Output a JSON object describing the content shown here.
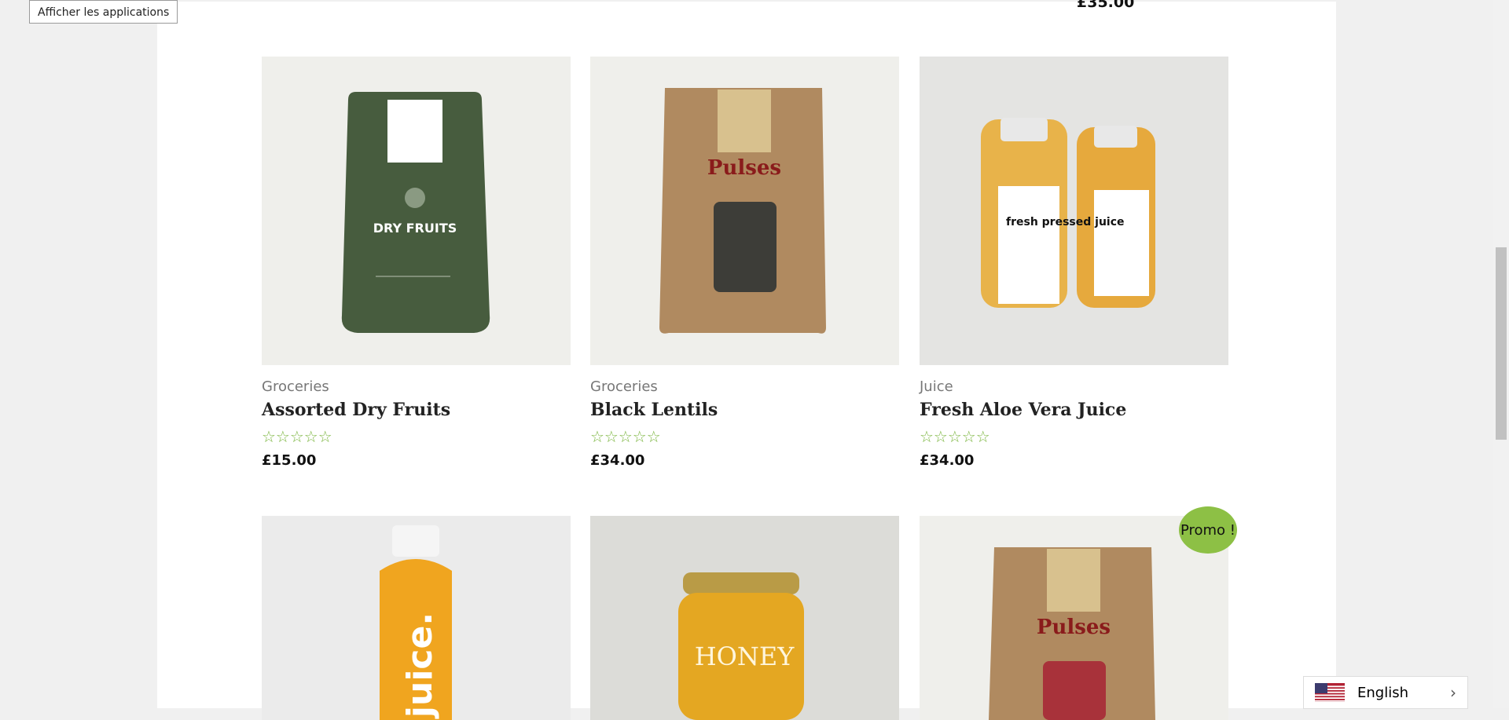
{
  "tooltip": "Afficher les applications",
  "top_price": "£35.00",
  "products": [
    {
      "category": "Groceries",
      "title": "Assorted Dry Fruits",
      "price": "£15.00",
      "rating": "☆☆☆☆☆",
      "image_text": "DRY FRUITS"
    },
    {
      "category": "Groceries",
      "title": "Black Lentils",
      "price": "£34.00",
      "rating": "☆☆☆☆☆",
      "image_text": "Pulses"
    },
    {
      "category": "Juice",
      "title": "Fresh Aloe Vera Juice",
      "price": "£34.00",
      "rating": "☆☆☆☆☆",
      "image_text": "fresh pressed juice"
    }
  ],
  "row2": [
    {
      "image_text": "juice."
    },
    {
      "image_text": "HONEY"
    },
    {
      "image_text": "Pulses"
    }
  ],
  "promo_badge": "Promo !",
  "language": {
    "label": "English",
    "flag": "us-flag-icon"
  },
  "colors": {
    "accent": "#8dc045",
    "stars": "#7ab53d"
  }
}
